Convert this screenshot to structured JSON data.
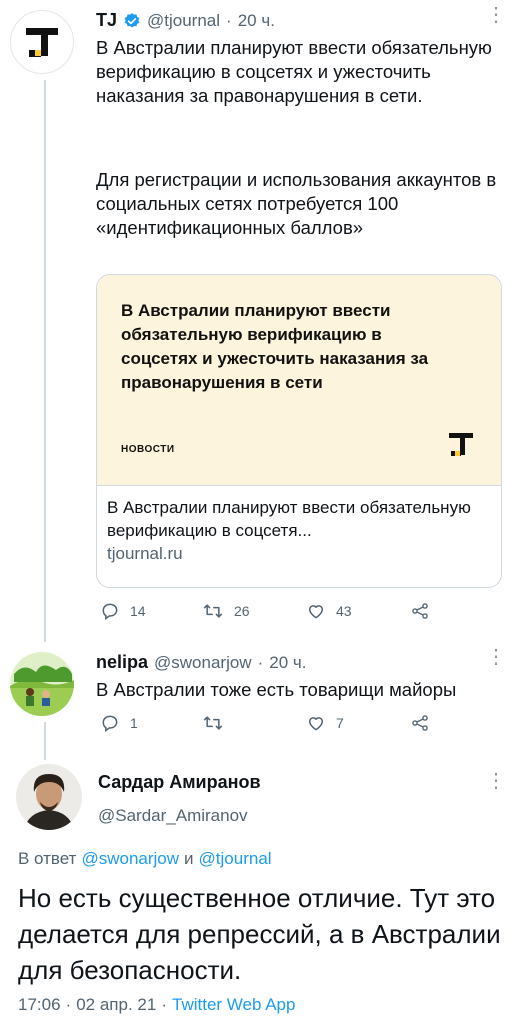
{
  "tweet1": {
    "author_name": "TJ",
    "handle": "@tjournal",
    "sep": "·",
    "time": "20 ч.",
    "text_p1": "В Австралии планируют ввести обязательную верификацию в соцсетях и ужесточить наказания за правонарушения в сети.",
    "text_p2": "Для регистрации и использования аккаунтов в социальных сетях потребуется 100 «идентификационных баллов»",
    "card": {
      "image_title": "В Австралии планируют ввести обязательную верификацию в соцсетях и ужесточить наказания за  правонарушения в сети",
      "image_tag": "НОВОСТИ",
      "title": "В Австралии планируют ввести обязательную верификацию в соцсетя...",
      "domain": "tjournal.ru"
    },
    "actions": {
      "replies": "14",
      "retweets": "26",
      "likes": "43"
    }
  },
  "tweet2": {
    "author_name": "nelipa",
    "handle": "@swonarjow",
    "sep": "·",
    "time": "20 ч.",
    "text": "В Австралии тоже есть товарищи майоры",
    "actions": {
      "replies": "1",
      "retweets": "",
      "likes": "7"
    }
  },
  "tweet3": {
    "author_name": "Сардар Амиранов",
    "handle": "@Sardar_Amiranov",
    "reply_prefix": "В ответ",
    "reply_user1": "@swonarjow",
    "reply_and": "и",
    "reply_user2": "@tjournal",
    "text": "Но есть существенное отличие. Тут это делается для репрессий, а в Австралии для безопасности.",
    "time": "17:06",
    "date": "02 апр. 21",
    "source": "Twitter Web App"
  },
  "colors": {
    "accent": "#1d9bf0",
    "muted": "#536471",
    "card_bg": "#fcf4dd",
    "tj_yellow": "#ffc933"
  }
}
